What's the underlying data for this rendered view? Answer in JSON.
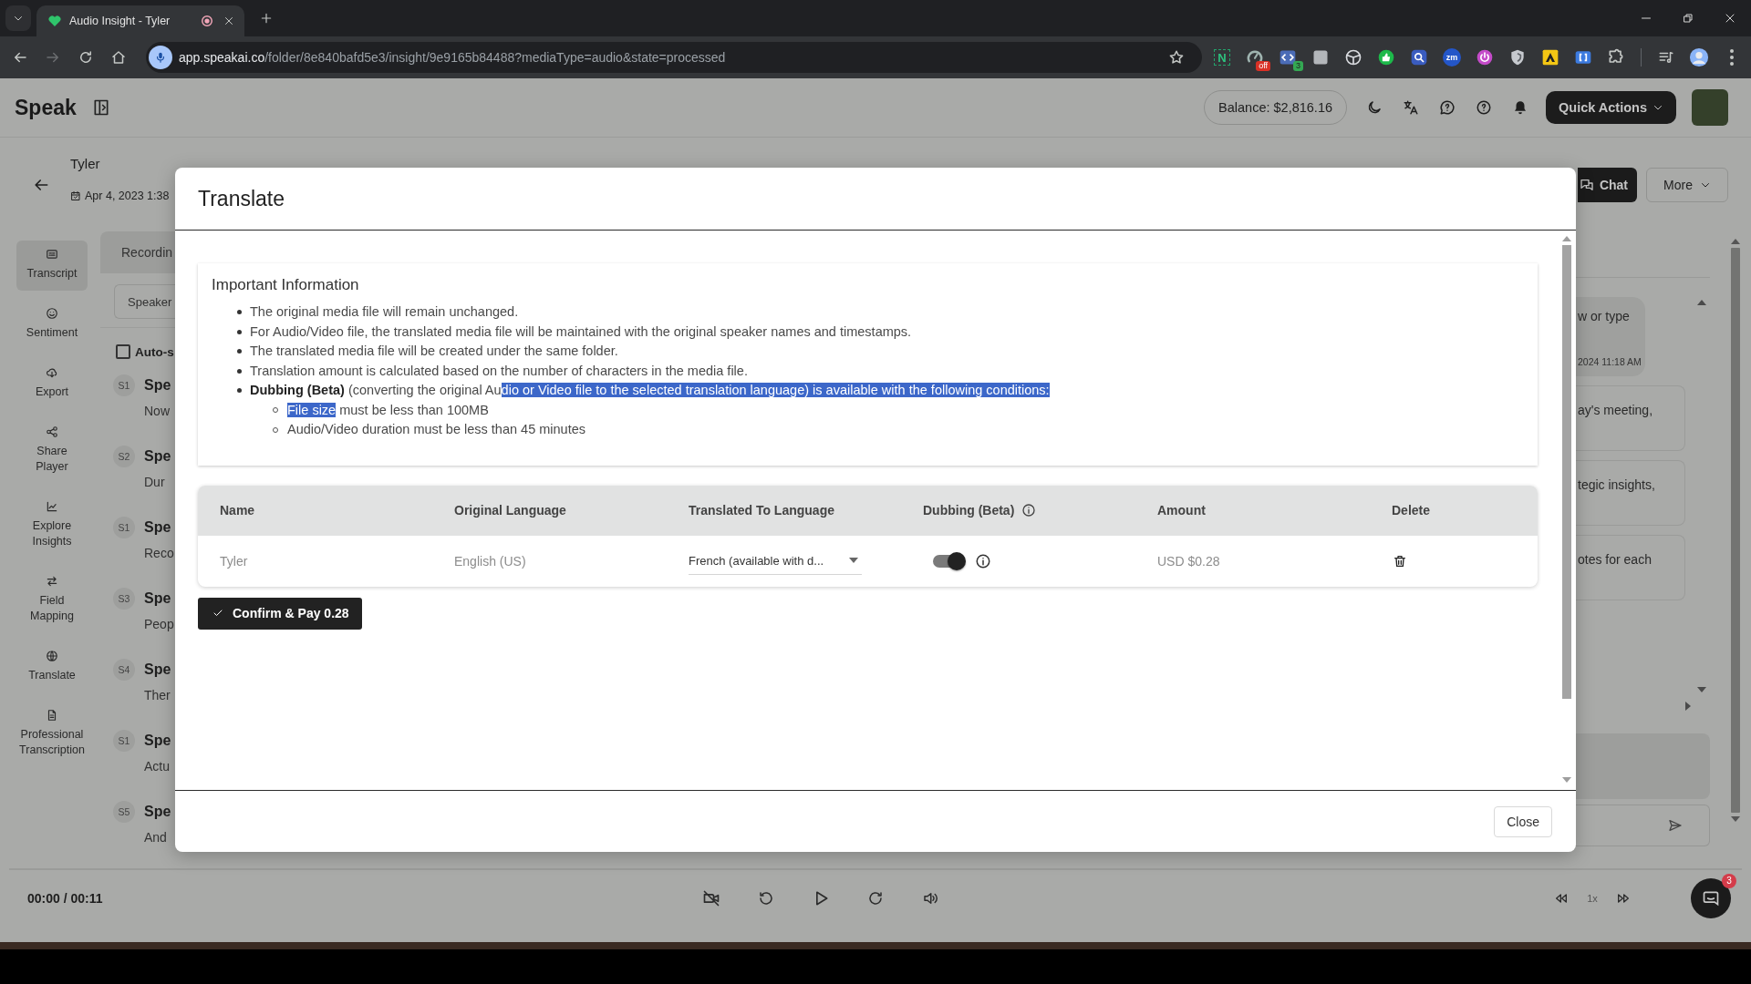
{
  "browser": {
    "tab_title": "Audio Insight - Tyler",
    "url_host": "app.speakai.co",
    "url_rest": "/folder/8e840bafd5e3/insight/9e9165b84488?mediaType=audio&state=processed",
    "extensions": [
      {
        "kind": "letter",
        "label": "N"
      },
      {
        "kind": "gauge",
        "badge": "off"
      },
      {
        "kind": "code",
        "badge": "3"
      },
      {
        "kind": "tile"
      },
      {
        "kind": "wheel"
      },
      {
        "kind": "thumb"
      },
      {
        "kind": "magnifier"
      },
      {
        "kind": "disc",
        "label": "zm"
      },
      {
        "kind": "power"
      },
      {
        "kind": "shield"
      },
      {
        "kind": "warning"
      },
      {
        "kind": "bracket"
      },
      {
        "kind": "puzzle"
      }
    ]
  },
  "header": {
    "logo": "Speak",
    "balance": "Balance: $2,816.16",
    "quick_actions": "Quick Actions"
  },
  "page": {
    "title": "Tyler",
    "date": "Apr 4, 2023 1:38",
    "chat_button": "Chat",
    "more_button": "More"
  },
  "nav": [
    {
      "label": "Transcript",
      "selected": true
    },
    {
      "label": "Sentiment",
      "selected": false
    },
    {
      "label": "Export",
      "selected": false
    },
    {
      "label": "Share Player",
      "selected": false
    },
    {
      "label": "Explore Insights",
      "selected": false
    },
    {
      "label": "Field Mapping",
      "selected": false
    },
    {
      "label": "Translate",
      "selected": false
    },
    {
      "label": "Professional Transcription",
      "selected": false
    }
  ],
  "transcript": {
    "tab": "Recordin",
    "speaker_filter": "Speaker",
    "auto_scroll": {
      "label": "Auto-s",
      "checked": false
    },
    "segments": [
      {
        "speaker": "S1",
        "name": "Spe",
        "text": "Now"
      },
      {
        "speaker": "S2",
        "name": "Spe",
        "text": "Dur"
      },
      {
        "speaker": "S1",
        "name": "Spe",
        "text": "Reco"
      },
      {
        "speaker": "S3",
        "name": "Spe",
        "text": "Peop"
      },
      {
        "speaker": "S4",
        "name": "Spe",
        "text": "Ther"
      },
      {
        "speaker": "S1",
        "name": "Spe",
        "text": "Actu"
      },
      {
        "speaker": "S5",
        "name": "Spe",
        "text": "And"
      }
    ]
  },
  "chat": {
    "messages": [
      {
        "kind": "bubble",
        "text": "w or type",
        "time": "2024 11:18 AM"
      },
      {
        "kind": "card",
        "text": "ay's meeting,"
      },
      {
        "kind": "card",
        "text": "tegic insights,"
      },
      {
        "kind": "card",
        "text": "otes for each"
      }
    ]
  },
  "modal": {
    "title": "Translate",
    "info": {
      "heading": "Important Information",
      "items": [
        {
          "segments": [
            {
              "text": "The original media file will remain unchanged.",
              "highlighted": false
            }
          ]
        },
        {
          "segments": [
            {
              "text": "For Audio/Video file, the translated media file will be maintained with the original speaker names and timestamps.",
              "highlighted": false
            }
          ]
        },
        {
          "segments": [
            {
              "text": "The translated media file will be created under the same folder.",
              "highlighted": false
            }
          ]
        },
        {
          "segments": [
            {
              "text": "Translation amount is calculated based on the number of characters in the media file.",
              "highlighted": false
            }
          ]
        },
        {
          "segments": [
            {
              "text": "**Dubbing (Beta)** (converting the original Au",
              "highlighted": false
            },
            {
              "text": "dio or Video file to the selected translation language) is available with the following conditions:",
              "highlighted": true
            }
          ],
          "children": [
            {
              "segments": [
                {
                  "text": "File size",
                  "highlighted": true
                },
                {
                  "text": " must be less than 100MB",
                  "highlighted": false
                }
              ]
            },
            {
              "segments": [
                {
                  "text": "Audio/Video duration must be less than 45 minutes",
                  "highlighted": false
                }
              ]
            }
          ]
        }
      ]
    },
    "table": {
      "columns": [
        {
          "label": "Name",
          "kind": "plain"
        },
        {
          "label": "Original Language",
          "kind": "plain"
        },
        {
          "label": "Translated To Language",
          "kind": "plain"
        },
        {
          "label": "Dubbing (Beta)",
          "kind": "info"
        },
        {
          "label": "Amount",
          "kind": "plain"
        },
        {
          "label": "Delete",
          "kind": "plain"
        }
      ],
      "rows": [
        {
          "name": "Tyler",
          "original_language": "English (US)",
          "translated_language": "French (available with d...",
          "dubbing": true,
          "amount": "USD $0.28"
        }
      ]
    },
    "confirm_button": "Confirm & Pay 0.28",
    "close_button": "Close"
  },
  "player": {
    "time": "00:00 / 00:11",
    "speed": "1x",
    "chat_badge": "3"
  }
}
